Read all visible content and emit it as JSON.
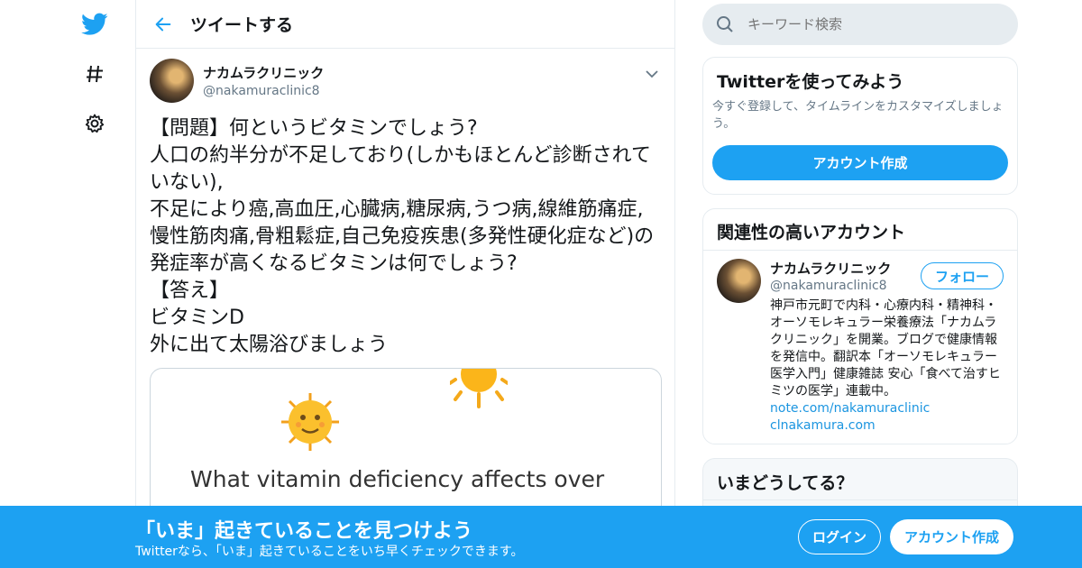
{
  "icons": {
    "twitter": "twitter-bird-icon",
    "explore": "hashtag-icon",
    "settings": "gear-icon",
    "back": "back-arrow-icon",
    "caret": "chevron-down-icon",
    "search": "search-icon"
  },
  "colors": {
    "accent": "#1da1f2",
    "link": "#1b95e0",
    "muted": "#657786"
  },
  "header": {
    "title": "ツイートする"
  },
  "tweet": {
    "author_name": "ナカムラクリニック",
    "author_handle": "@nakamuraclinic8",
    "text": "【問題】何というビタミンでしょう?\n人口の約半分が不足しており(しかもほとんど診断されていない),\n不足により癌,高血圧,心臓病,糖尿病,うつ病,線維筋痛症,慢性筋肉痛,骨粗鬆症,自己免疫疾患(多発性硬化症など)の発症率が高くなるビタミンは何でしょう?\n【答え】\nビタミンD\n外に出て太陽浴びましょう",
    "media_text": "What vitamin deficiency affects over"
  },
  "search": {
    "placeholder": "キーワード検索"
  },
  "signup_card": {
    "title": "Twitterを使ってみよう",
    "description": "今すぐ登録して、タイムラインをカスタマイズしましょう。",
    "button": "アカウント作成"
  },
  "related_card": {
    "title": "関連性の高いアカウント",
    "account_name": "ナカムラクリニック",
    "account_handle": "@nakamuraclinic8",
    "follow_button": "フォロー",
    "bio": "神戸市元町で内科・心療内科・精神科・オーソモレキュラー栄養療法「ナカムラクリニック」を開業。ブログで健康情報を発信中。翻訳本「オーソモレキュラー医学入門」健康雑誌 安心「食べて治すヒミツの医学」連載中。",
    "links": [
      "note.com/nakamuraclinic",
      "clnakamura.com"
    ]
  },
  "trends_card": {
    "title": "いまどうしてる？"
  },
  "bottom_bar": {
    "title": "「いま」起きていることを見つけよう",
    "subtitle": "Twitterなら、「いま」起きていることをいち早くチェックできます。",
    "login": "ログイン",
    "signup": "アカウント作成"
  }
}
